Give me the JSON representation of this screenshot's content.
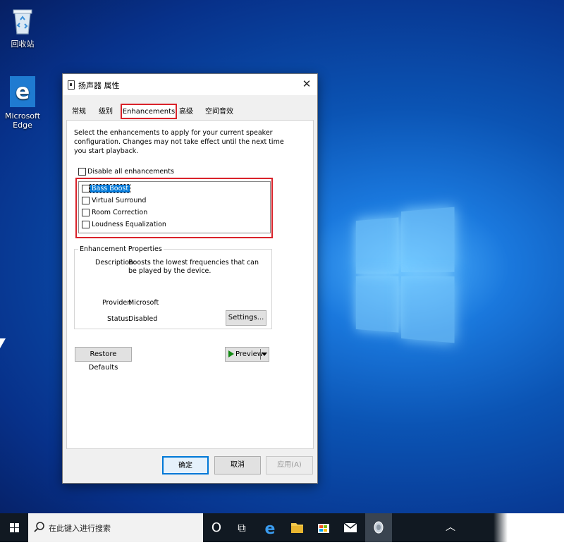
{
  "desktop": {
    "icons": [
      {
        "label": "回收站"
      },
      {
        "label": "Microsoft\nEdge"
      }
    ]
  },
  "dialog": {
    "title": "扬声器 属性",
    "tabs": [
      "常规",
      "级别",
      "Enhancements",
      "高级",
      "空间音效"
    ],
    "active_tab": "Enhancements",
    "instructions": "Select the enhancements to apply for your current speaker configuration. Changes may not take effect until the next time you start playback.",
    "disable_all_label": "Disable all enhancements",
    "enhancements": [
      {
        "label": "Bass Boost",
        "checked": false,
        "selected": true
      },
      {
        "label": "Virtual Surround",
        "checked": false
      },
      {
        "label": "Room Correction",
        "checked": false
      },
      {
        "label": "Loudness Equalization",
        "checked": false
      }
    ],
    "properties": {
      "group_title": "Enhancement Properties",
      "description_label": "Description:",
      "description": "Boosts the lowest frequencies that can be played by the device.",
      "provider_label": "Provider:",
      "provider": "Microsoft",
      "status_label": "Status:",
      "status": "Disabled",
      "settings_button": "Settings..."
    },
    "restore_defaults_button": "Restore Defaults",
    "preview_button": "Preview",
    "ok_button": "确定",
    "cancel_button": "取消",
    "apply_button": "应用(A)",
    "highlight_color": "#d9222a"
  },
  "taskbar": {
    "search_placeholder": "在此键入进行搜索",
    "cortana_glyph": "O",
    "taskview_glyph": "⧉"
  }
}
